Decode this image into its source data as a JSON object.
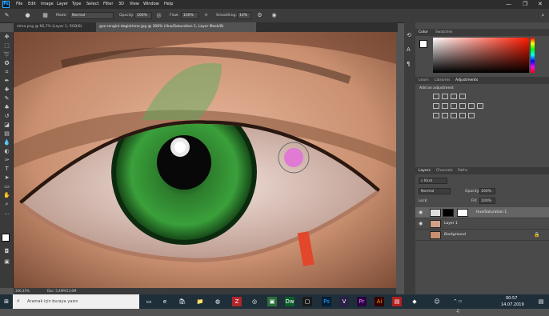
{
  "menu": [
    "File",
    "Edit",
    "Image",
    "Layer",
    "Type",
    "Select",
    "Filter",
    "3D",
    "View",
    "Window",
    "Help"
  ],
  "window_controls": [
    "—",
    "❐",
    "✕"
  ],
  "options_bar": {
    "mode_label": "Mode:",
    "mode_value": "Normal",
    "opacity_label": "Opacity:",
    "opacity_value": "100%",
    "flow_label": "Flow:",
    "flow_value": "100%",
    "smoothing_label": "Smoothing:",
    "smoothing_value": "10%"
  },
  "tabs": [
    {
      "label": "elma.png @ 66,7% (Layer 1, RGB/8)",
      "active": false
    },
    {
      "label": "goz-rengini-degistirme.jpg @ 306% (Hue/Saturation 1, Layer Mask/8)",
      "active": true
    }
  ],
  "status": {
    "zoom": "306,35%",
    "doc": "Doc: 5,49M/13,6M"
  },
  "color_panel": {
    "tabs": [
      "Color",
      "Swatches"
    ]
  },
  "adjustments_panel": {
    "tabs": [
      "Learn",
      "Libraries",
      "Adjustments"
    ],
    "heading": "Add an adjustment"
  },
  "layers_panel": {
    "tabs": [
      "Layers",
      "Channels",
      "Paths"
    ],
    "kind_label": "Kind",
    "blend_mode": "Normal",
    "opacity_label": "Opacity:",
    "opacity_value": "100%",
    "lock_label": "Lock:",
    "fill_label": "Fill:",
    "fill_value": "100%",
    "layers": [
      {
        "name": "Hue/Saturation 1",
        "selected": true
      },
      {
        "name": "Layer 1",
        "selected": false
      },
      {
        "name": "Background",
        "selected": false
      }
    ]
  },
  "taskbar": {
    "search_placeholder": "Aramak için buraya yazın",
    "time": "00:57",
    "date": "14.07.2019"
  },
  "colors": {
    "accent": "#31a8ff",
    "menu_bg": "#2d2d2d",
    "taskbar_bg": "#1f2f3a"
  }
}
